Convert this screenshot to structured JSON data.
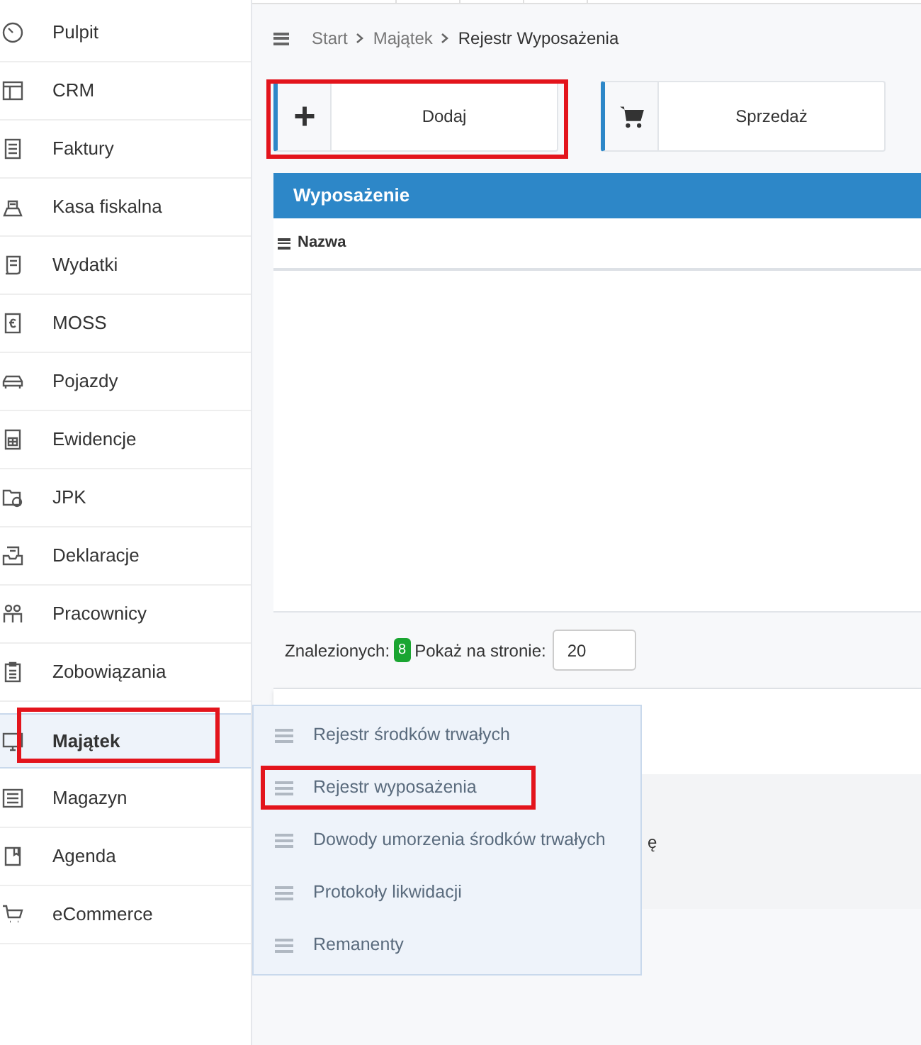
{
  "sidebar": {
    "items": [
      {
        "label": "Pulpit",
        "selected": false,
        "highlighted": false
      },
      {
        "label": "CRM",
        "selected": false,
        "highlighted": false
      },
      {
        "label": "Faktury",
        "selected": false,
        "highlighted": false
      },
      {
        "label": "Kasa fiskalna",
        "selected": false,
        "highlighted": false
      },
      {
        "label": "Wydatki",
        "selected": false,
        "highlighted": false
      },
      {
        "label": "MOSS",
        "selected": false,
        "highlighted": false
      },
      {
        "label": "Pojazdy",
        "selected": false,
        "highlighted": false
      },
      {
        "label": "Ewidencje",
        "selected": false,
        "highlighted": false
      },
      {
        "label": "JPK",
        "selected": false,
        "highlighted": false
      },
      {
        "label": "Deklaracje",
        "selected": false,
        "highlighted": false
      },
      {
        "label": "Pracownicy",
        "selected": false,
        "highlighted": false
      },
      {
        "label": "Zobowiązania",
        "selected": false,
        "highlighted": false
      },
      {
        "label": "Majątek",
        "selected": true,
        "highlighted": true
      },
      {
        "label": "Magazyn",
        "selected": false,
        "highlighted": false
      },
      {
        "label": "Agenda",
        "selected": false,
        "highlighted": false
      },
      {
        "label": "eCommerce",
        "selected": false,
        "highlighted": false
      }
    ]
  },
  "submenu": {
    "items": [
      {
        "label": "Rejestr środków trwałych",
        "highlighted": false
      },
      {
        "label": "Rejestr wyposażenia",
        "highlighted": true
      },
      {
        "label": "Dowody umorzenia środków trwałych",
        "highlighted": false
      },
      {
        "label": "Protokoły likwidacji",
        "highlighted": false
      },
      {
        "label": "Remanenty",
        "highlighted": false
      }
    ]
  },
  "breadcrumb": [
    "Start",
    "Majątek",
    "Rejestr Wyposażenia"
  ],
  "actions": [
    {
      "label": "Dodaj",
      "highlighted": true
    },
    {
      "label": "Sprzedaż",
      "highlighted": false
    }
  ],
  "table": {
    "title": "Wyposażenie",
    "columns": [
      "Nazwa"
    ],
    "found_label": "Znalezionych:",
    "found_count": "8",
    "per_page_label": "Pokaż na stronie:",
    "per_page": "20"
  },
  "hidden_text": "ę"
}
